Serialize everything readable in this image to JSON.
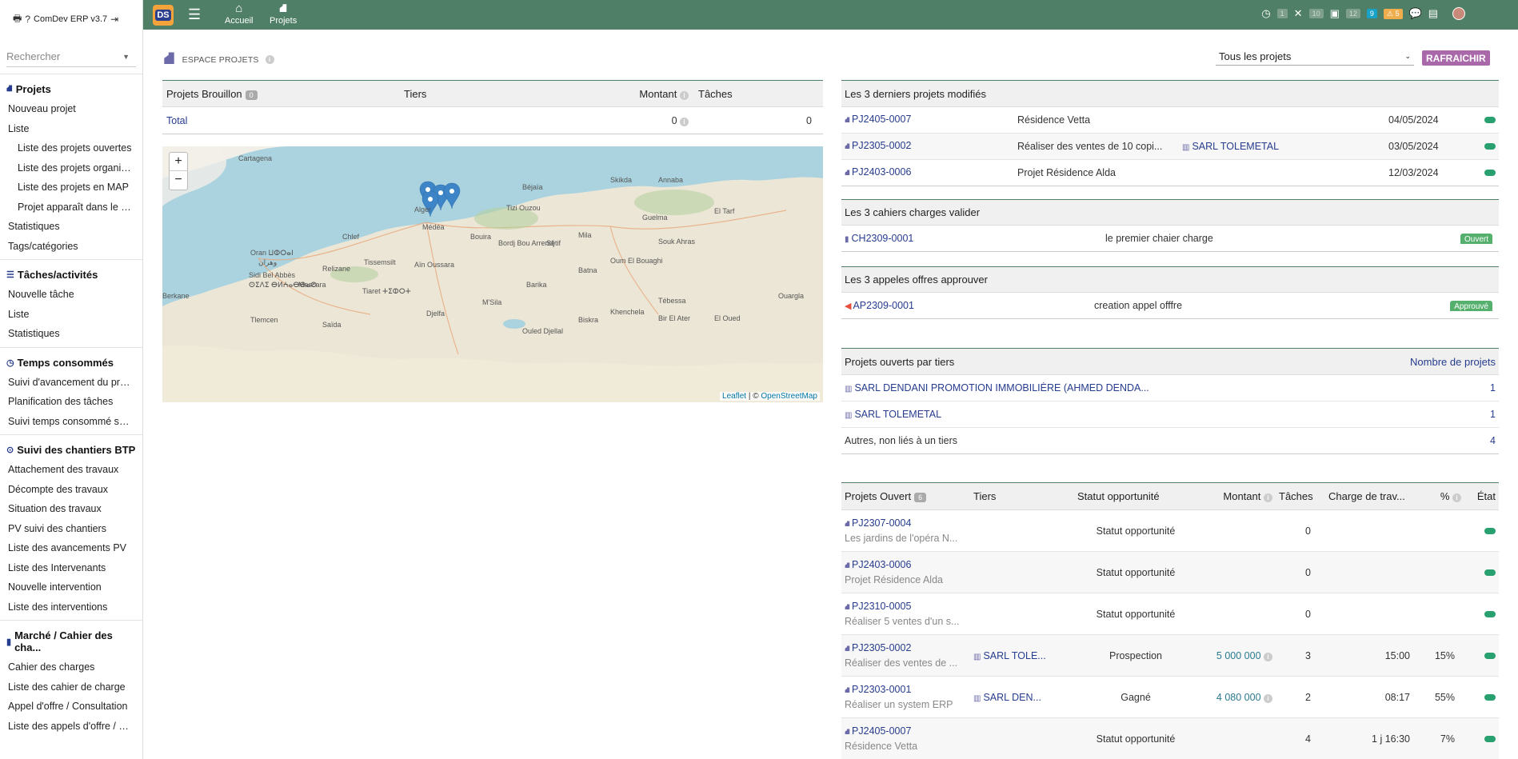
{
  "app": {
    "brand": "ComDev ERP v3.7",
    "logo": "DS"
  },
  "search": {
    "placeholder": "Rechercher"
  },
  "sidebar": {
    "sections": [
      {
        "title": "Projets",
        "items": [
          {
            "label": "Nouveau projet",
            "sub": false
          },
          {
            "label": "Liste",
            "sub": false
          },
          {
            "label": "Liste des projets ouvertes",
            "sub": true
          },
          {
            "label": "Liste des projets organisés",
            "sub": true
          },
          {
            "label": "Liste des projets en MAP",
            "sub": true
          },
          {
            "label": "Projet apparaît dans le sit...",
            "sub": true
          },
          {
            "label": "Statistiques",
            "sub": false
          },
          {
            "label": "Tags/catégories",
            "sub": false
          }
        ]
      },
      {
        "title": "Tâches/activités",
        "items": [
          {
            "label": "Nouvelle tâche",
            "sub": false
          },
          {
            "label": "Liste",
            "sub": false
          },
          {
            "label": "Statistiques",
            "sub": false
          }
        ]
      },
      {
        "title": "Temps consommés",
        "items": [
          {
            "label": "Suivi d'avancement du projet",
            "sub": false
          },
          {
            "label": "Planification des tâches",
            "sub": false
          },
          {
            "label": "Suivi temps consommé sur...",
            "sub": false
          }
        ]
      },
      {
        "title": "Suivi des chantiers BTP",
        "items": [
          {
            "label": "Attachement des travaux",
            "sub": false
          },
          {
            "label": "Décompte des travaux",
            "sub": false
          },
          {
            "label": "Situation des travaux",
            "sub": false
          },
          {
            "label": "PV suivi des chantiers",
            "sub": false
          },
          {
            "label": "Liste des avancements PV",
            "sub": false
          },
          {
            "label": "Liste des Intervenants",
            "sub": false
          },
          {
            "label": "Nouvelle intervention",
            "sub": false
          },
          {
            "label": "Liste des interventions",
            "sub": false
          }
        ]
      },
      {
        "title": "Marché / Cahier des cha...",
        "items": [
          {
            "label": "Cahier des charges",
            "sub": false
          },
          {
            "label": "Liste des cahier de charge",
            "sub": false
          },
          {
            "label": "Appel d'offre / Consultation",
            "sub": false
          },
          {
            "label": "Liste des appels d'offre / Co...",
            "sub": false
          }
        ]
      }
    ]
  },
  "topbar": {
    "nav": [
      {
        "label": "Accueil",
        "icon": "home-icon"
      },
      {
        "label": "Projets",
        "icon": "project-icon"
      }
    ],
    "badges": {
      "clock": "1",
      "tools": "10",
      "calendar": "12",
      "blue": "9",
      "warn": "5"
    }
  },
  "header": {
    "title": "ESPACE PROJETS",
    "select_value": "Tous les projets",
    "refresh": "RAFRAICHIR"
  },
  "draft": {
    "headers": {
      "projects": "Projets Brouillon",
      "count": "0",
      "tiers": "Tiers",
      "montant": "Montant",
      "taches": "Tâches"
    },
    "total": {
      "label": "Total",
      "montant": "0",
      "taches": "0"
    }
  },
  "map": {
    "cities": [
      "Cartagena",
      "Oran ⵡⵀⵔⴰⵏ",
      "وهران",
      "Sidi Bel Abbès",
      "ⵙⵉⴷⵉ ⴱⵍⵄⴰⴱⴱⴰⵙ",
      "Tiaret ⵜⵉⵀⵔⵜ",
      "Alger",
      "Médéa",
      "Béjaïa",
      "Tizi Ouzou",
      "Sétif",
      "Batna",
      "Biskra",
      "Djelfa",
      "Mila",
      "Annaba",
      "Guelma",
      "Souk Ahras",
      "Tébessa",
      "Ouargla",
      "El Oued",
      "Chlef",
      "Relizane",
      "Saïda",
      "Mascara",
      "Tlemcen",
      "M'Sila",
      "Barika",
      "Khenchela",
      "Bordj Bou Arreridj",
      "Bouira",
      "Oum El Bouaghi",
      "Skikda",
      "Tissemsilt",
      "Aïn Oussara",
      "Ouled Djellal",
      "Bir El Ater",
      "El Tarf",
      "Berkane"
    ],
    "zoom_in": "+",
    "zoom_out": "−",
    "attribution_leaflet": "Leaflet",
    "attribution_sep": "| ©",
    "attribution_osm": "OpenStreetMap"
  },
  "last_modified": {
    "title": "Les 3 derniers projets modifiés",
    "rows": [
      {
        "ref": "PJ2405-0007",
        "label": "Résidence Vetta",
        "tiers": "",
        "date": "04/05/2024"
      },
      {
        "ref": "PJ2305-0002",
        "label": "Réaliser des ventes de 10 copi...",
        "tiers": "SARL TOLEMETAL",
        "date": "03/05/2024"
      },
      {
        "ref": "PJ2403-0006",
        "label": "Projet Résidence Alda",
        "tiers": "",
        "date": "12/03/2024"
      }
    ]
  },
  "cahiers": {
    "title": "Les 3 cahiers charges valider",
    "rows": [
      {
        "ref": "CH2309-0001",
        "label": "le premier chaier charge",
        "status": "Ouvert"
      }
    ]
  },
  "appels": {
    "title": "Les 3 appeles offres approuver",
    "rows": [
      {
        "ref": "AP2309-0001",
        "label": "creation appel offfre",
        "status": "Approuvé"
      }
    ]
  },
  "par_tiers": {
    "title": "Projets ouverts par tiers",
    "count_header": "Nombre de projets",
    "rows": [
      {
        "label": "SARL DENDANI PROMOTION IMMOBILIÈRE (AHMED DENDA...",
        "count": "1",
        "icon": true
      },
      {
        "label": "SARL TOLEMETAL",
        "count": "1",
        "icon": true
      },
      {
        "label": "Autres, non liés à un tiers",
        "count": "4",
        "icon": false
      }
    ]
  },
  "open": {
    "headers": {
      "projects": "Projets Ouvert",
      "count": "6",
      "tiers": "Tiers",
      "statut": "Statut opportunité",
      "montant": "Montant",
      "taches": "Tâches",
      "charge": "Charge de trav...",
      "pct": "%",
      "etat": "État"
    },
    "rows": [
      {
        "ref": "PJ2307-0004",
        "label": "Les jardins de l'opéra N...",
        "tiers": "",
        "statut": "Statut opportunité",
        "montant": "",
        "taches": "0",
        "charge": "",
        "pct": ""
      },
      {
        "ref": "PJ2403-0006",
        "label": "Projet Résidence Alda",
        "tiers": "",
        "statut": "Statut opportunité",
        "montant": "",
        "taches": "0",
        "charge": "",
        "pct": ""
      },
      {
        "ref": "PJ2310-0005",
        "label": "Réaliser 5 ventes d'un s...",
        "tiers": "",
        "statut": "Statut opportunité",
        "montant": "",
        "taches": "0",
        "charge": "",
        "pct": ""
      },
      {
        "ref": "PJ2305-0002",
        "label": "Réaliser des ventes de ...",
        "tiers": "SARL TOLE...",
        "statut": "Prospection",
        "montant": "5 000 000",
        "taches": "3",
        "charge": "15:00",
        "pct": "15%"
      },
      {
        "ref": "PJ2303-0001",
        "label": "Réaliser un system ERP",
        "tiers": "SARL DEN...",
        "statut": "Gagné",
        "montant": "4 080 000",
        "taches": "2",
        "charge": "08:17",
        "pct": "55%"
      },
      {
        "ref": "PJ2405-0007",
        "label": "Résidence Vetta",
        "tiers": "",
        "statut": "Statut opportunité",
        "montant": "",
        "taches": "4",
        "charge": "1 j 16:30",
        "pct": "7%"
      }
    ]
  },
  "colors": {
    "topbar": "#4f7f66",
    "link": "#263c8e",
    "refresh": "#a968a9",
    "status_green": "#28a070"
  }
}
